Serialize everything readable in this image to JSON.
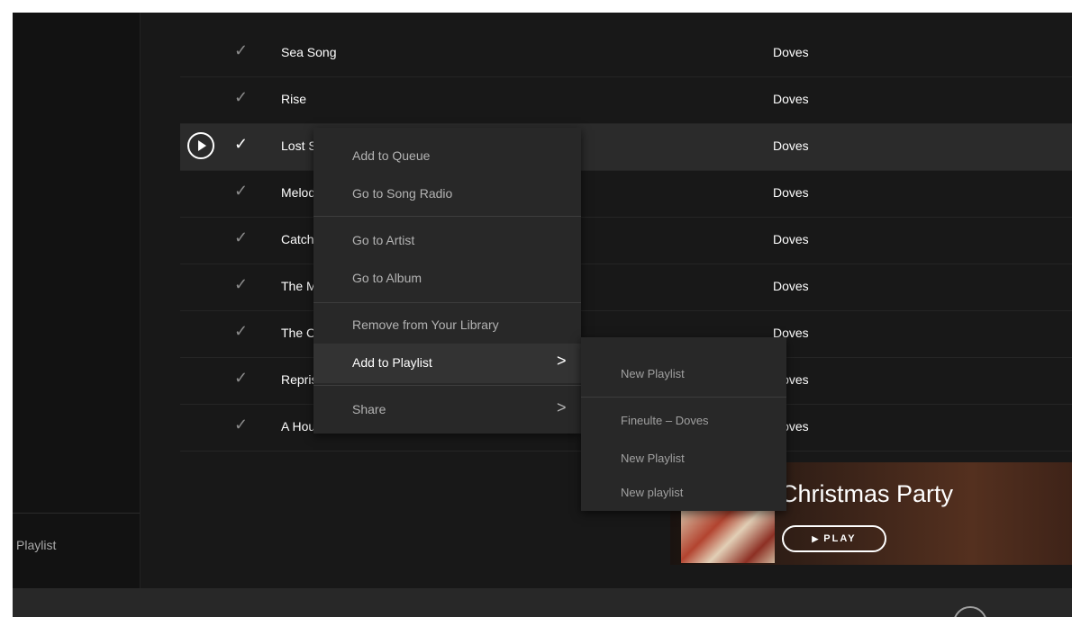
{
  "sidebar": {
    "playlist_label": "Playlist"
  },
  "tracks": [
    {
      "title": "Sea Song",
      "artist": "Doves"
    },
    {
      "title": "Rise",
      "artist": "Doves"
    },
    {
      "title": "Lost Souls",
      "artist": "Doves"
    },
    {
      "title": "Melody",
      "artist": "Doves"
    },
    {
      "title": "Catch",
      "artist": "Doves"
    },
    {
      "title": "The Man",
      "artist": "Doves"
    },
    {
      "title": "The Cedar",
      "artist": "Doves"
    },
    {
      "title": "Reprise",
      "artist": "Doves"
    },
    {
      "title": "A House",
      "artist": "Doves"
    }
  ],
  "context_menu": {
    "items": [
      {
        "label": "Add to Queue"
      },
      {
        "label": "Go to Song Radio"
      },
      {
        "label": "Go to Artist"
      },
      {
        "label": "Go to Album"
      },
      {
        "label": "Remove from Your Library"
      },
      {
        "label": "Add to Playlist",
        "chevron": ">"
      },
      {
        "label": "Share",
        "chevron": ">"
      }
    ]
  },
  "playlist_submenu": {
    "items": [
      {
        "label": "New Playlist"
      },
      {
        "label": "Fineulte – Doves"
      },
      {
        "label": "New Playlist"
      },
      {
        "label": "New playlist"
      }
    ]
  },
  "banner": {
    "title": "Christmas Party",
    "play_label": "PLAY",
    "play_glyph": "▶"
  },
  "icons": {
    "check": "✓",
    "play": "play-circle-icon",
    "chevron": "chevron-right-icon"
  },
  "colors": {
    "background": "#181818",
    "sidebar": "#121212",
    "menu": "#282828",
    "text": "#ffffff",
    "muted": "#b3b3b3"
  }
}
